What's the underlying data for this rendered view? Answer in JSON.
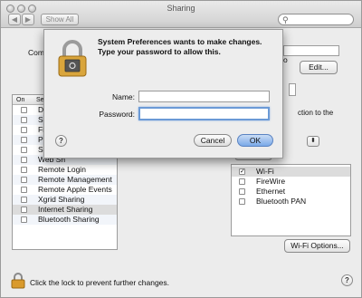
{
  "window": {
    "title": "Sharing",
    "show_all_label": "Show All",
    "search_placeholder": ""
  },
  "background": {
    "computer_name_label": "Com",
    "computer_name_suffix": "o",
    "edit_label": "Edit...",
    "service_header_on": "On",
    "service_header_service": "Se",
    "services": [
      {
        "name": "DV",
        "checked": false
      },
      {
        "name": "Sc",
        "checked": false
      },
      {
        "name": "Fi",
        "checked": false
      },
      {
        "name": "Pr",
        "checked": false
      },
      {
        "name": "Sc",
        "checked": false
      },
      {
        "name": "Web Sh",
        "checked": false
      },
      {
        "name": "Remote Login",
        "checked": false
      },
      {
        "name": "Remote Management",
        "checked": false
      },
      {
        "name": "Remote Apple Events",
        "checked": false
      },
      {
        "name": "Xgrid Sharing",
        "checked": false
      },
      {
        "name": "Internet Sharing",
        "checked": false
      },
      {
        "name": "Bluetooth Sharing",
        "checked": false
      }
    ],
    "connection_text": "ction to the",
    "cancel_partial": "Cancel",
    "ports": [
      {
        "name": "Wi-Fi",
        "checked": true
      },
      {
        "name": "FireWire",
        "checked": false
      },
      {
        "name": "Ethernet",
        "checked": false
      },
      {
        "name": "Bluetooth PAN",
        "checked": false
      }
    ],
    "wifi_options_label": "Wi-Fi Options...",
    "lock_text": "Click the lock to prevent further changes."
  },
  "dialog": {
    "message_line1": "System Preferences wants to make changes.",
    "message_line2": "Type your password to allow this.",
    "name_label": "Name:",
    "name_value": "",
    "password_label": "Password:",
    "password_value": "",
    "cancel_label": "Cancel",
    "ok_label": "OK"
  },
  "icons": {
    "lock": "lock-icon",
    "help": "help-icon",
    "search": "search-icon"
  }
}
